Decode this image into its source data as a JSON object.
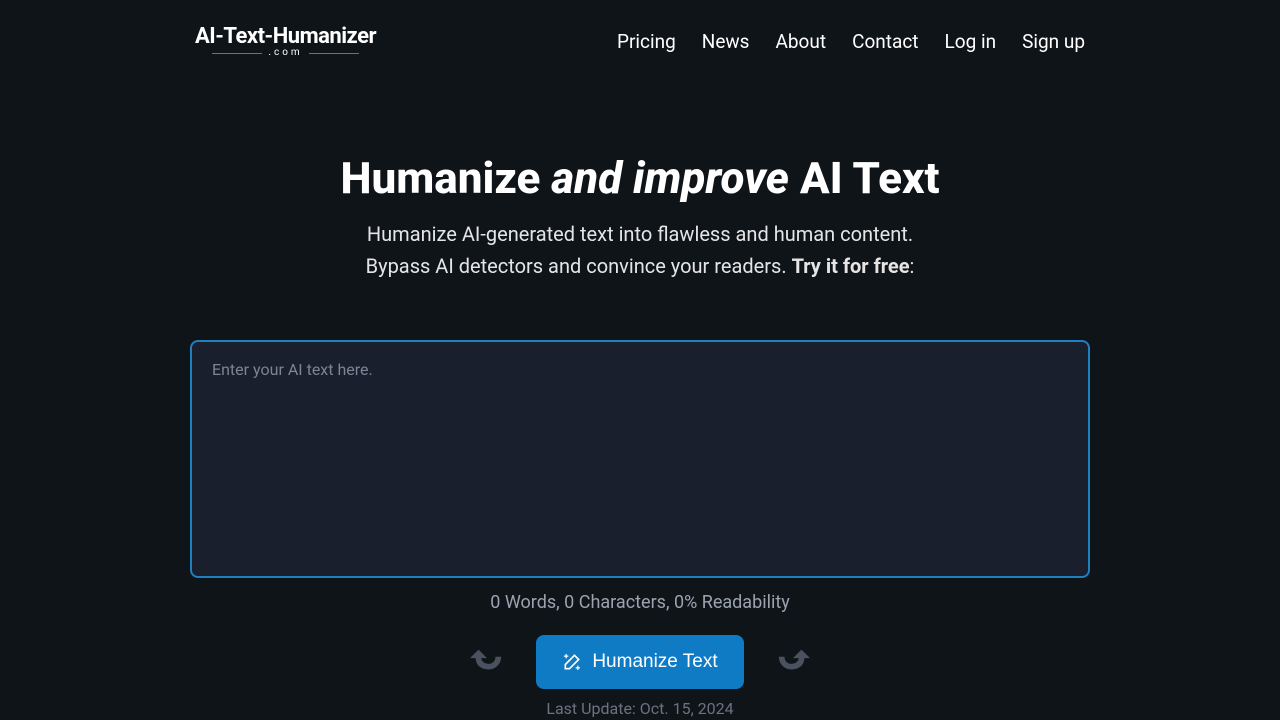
{
  "logo": {
    "main": "AI-Text-Humanizer",
    "sub": ".com"
  },
  "nav": {
    "pricing": "Pricing",
    "news": "News",
    "about": "About",
    "contact": "Contact",
    "login": "Log in",
    "signup": "Sign up"
  },
  "hero": {
    "title_prefix": "Humanize ",
    "title_em": "and improve",
    "title_suffix": " AI Text",
    "subtitle_line1": "Humanize AI-generated text into flawless and human content.",
    "subtitle_line2_a": "Bypass AI detectors and convince your readers. ",
    "subtitle_line2_b": "Try it for free",
    "subtitle_line2_c": ":"
  },
  "editor": {
    "placeholder": "Enter your AI text here."
  },
  "stats": {
    "words": 0,
    "characters": 0,
    "readability": 0,
    "text": "0 Words, 0 Characters, 0% Readability"
  },
  "button": {
    "label": "Humanize Text"
  },
  "footer": {
    "last_update": "Last Update: Oct. 15, 2024"
  }
}
